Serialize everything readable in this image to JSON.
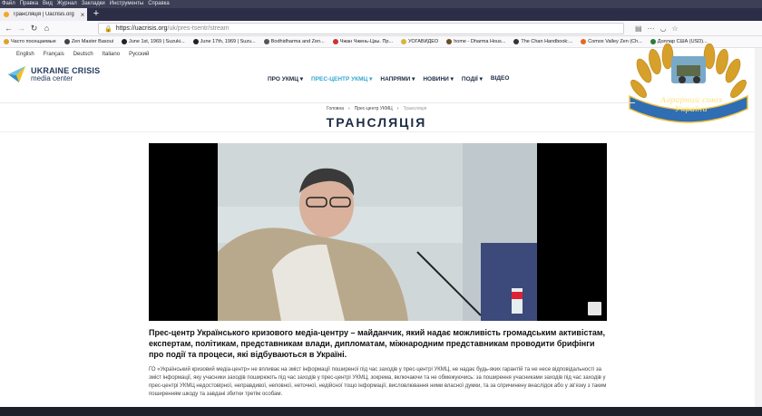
{
  "menu": [
    "Файл",
    "Правка",
    "Вид",
    "Журнал",
    "Закладки",
    "Инструменты",
    "Справка"
  ],
  "tab": {
    "title": "Трансляція | Uacrisis.org",
    "close": "×",
    "new": "+"
  },
  "url": {
    "host": "https://uacrisis.org",
    "path": "/uk/pres-tsentr/stream"
  },
  "bookmarks": [
    "Часто посещаемые",
    "Zen Master Basoui",
    "June 1st, 1969 | Suzuki...",
    "June 17th, 1969 | Suzu...",
    "Bodhidharma and Zen...",
    "Чжан Чжень-Цзы. Пр...",
    "УОГАВИДЕО",
    "home - Dharma Hous...",
    "The Chan Handbook:...",
    "Comox Valley Zen (Ch...",
    "Доллар США (USD)..."
  ],
  "languages": [
    "English",
    "Français",
    "Deutsch",
    "Italiano",
    "Русский"
  ],
  "logo": {
    "line1": "UKRAINE CRISIS",
    "line2": "media center"
  },
  "nav": [
    "ПРО УКМЦ ▾",
    "ПРЕС-ЦЕНТР УКМЦ ▾",
    "НАПРЯМИ ▾",
    "НОВИНИ ▾",
    "ПОДІЇ ▾",
    "ВІДЕО"
  ],
  "breadcrumb": [
    "Головна",
    "›",
    "Прес-центр УКМЦ",
    "›",
    "Трансляція"
  ],
  "page_title": "ТРАНСЛЯЦІЯ",
  "lead": "Прес-центр Українського кризового медіа-центру – майданчик, який надає можливість громадським активістам, експертам, політикам, представникам влади, дипломатам, міжнародним представникам проводити брифінги про події та процеси, які відбуваються в Україні.",
  "disclaimer": "ГО «Український кризовий медіа-центр» не впливає на зміст інформації поширеної під час заходів у прес-центрі УКМЦ, не надає будь-яких гарантій та не несе відповідальності за зміст інформації, яку учасники заходів поширюють під час заходів у прес-центрі УКМЦ, зокрема, включаючи та не обмежуючись: за поширення учасниками заходів під час заходів у прес-центрі УКМЦ недостовірної, неправдивої, неповної, неточної, недійсної тощо інформації, висловлювання ними власної думки, та за спричинену внаслідок або у зв'язку з таким поширенням шкоду та завдані збитки третім особам.",
  "badge": {
    "line1": "Аграрний союз",
    "line2": "України"
  },
  "colors": {
    "accent": "#33a6cf",
    "navy": "#1d2b44"
  }
}
